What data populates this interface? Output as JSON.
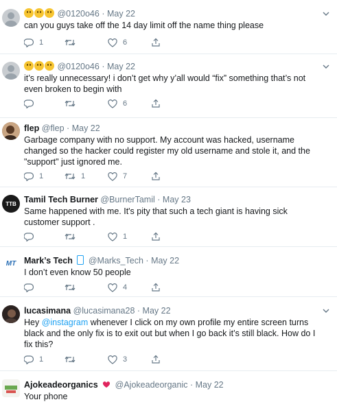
{
  "tweets": [
    {
      "name": "",
      "emoji_count": 3,
      "handle": "@0120o46",
      "date": "May 22",
      "text": "can you guys take off the 14 day limit off the name thing please",
      "reply": "1",
      "retweet": "",
      "like": "6"
    },
    {
      "name": "",
      "emoji_count": 3,
      "handle": "@0120o46",
      "date": "May 22",
      "text": "it’s really unnecessary! i don’t get why y’all would “fix” something that’s not even broken to begin with",
      "reply": "",
      "retweet": "",
      "like": "6"
    },
    {
      "name": "flep",
      "handle": "@flep",
      "date": "May 22",
      "text": "Garbage company with no support. My account was hacked, username changed so the hacker could register my old username and stole it, and the \"support\" just ignored me.",
      "reply": "1",
      "retweet": "1",
      "like": "7"
    },
    {
      "name": "Tamil Tech Burner",
      "handle": "@BurnerTamil",
      "date": "May 23",
      "text": "Same happened with me. It's pity that such a tech giant is having sick customer support .",
      "reply": "",
      "retweet": "",
      "like": "1"
    },
    {
      "name": "Mark’s Tech",
      "handle": "@Marks_Tech",
      "date": "May 22",
      "text": "I don’t even know 50 people",
      "reply": "",
      "retweet": "",
      "like": "4"
    },
    {
      "name": "lucasimana",
      "handle": "@lucasimana28",
      "date": "May 22",
      "text_before": "Hey ",
      "mention": "@instagram",
      "text_after": " whenever I click on my own profile my entire screen turns black and the only fix is to exit out but when I go back it’s still black. How do I fix this?",
      "reply": "1",
      "retweet": "",
      "like": "3"
    },
    {
      "name": "Ajokeadeorganics",
      "handle": "@Ajokeadeorganic",
      "date": "May 22",
      "text": "Your phone"
    }
  ],
  "separator": "·",
  "avatars": {
    "tamil_text": "TTB",
    "marks_text": "MT"
  },
  "colors": {
    "link": "#1da1f2",
    "muted": "#657786",
    "divider": "#e6ecf0"
  }
}
